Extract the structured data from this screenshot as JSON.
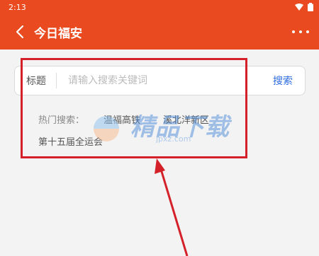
{
  "status_bar": {
    "time": "2:13"
  },
  "app_bar": {
    "title": "今日福安"
  },
  "search": {
    "label": "标题",
    "placeholder": "请输入搜索关键词",
    "button_label": "搜索"
  },
  "hot_search": {
    "label": "热门搜索：",
    "items": [
      "温福高铁",
      "溪北洋新区",
      "第十五届全运会"
    ]
  },
  "watermark": {
    "text": "精品下载",
    "url": "jpxz.com"
  },
  "colors": {
    "header": "#ea4a1f",
    "link": "#2d6cdf",
    "annotation": "#d42029"
  }
}
